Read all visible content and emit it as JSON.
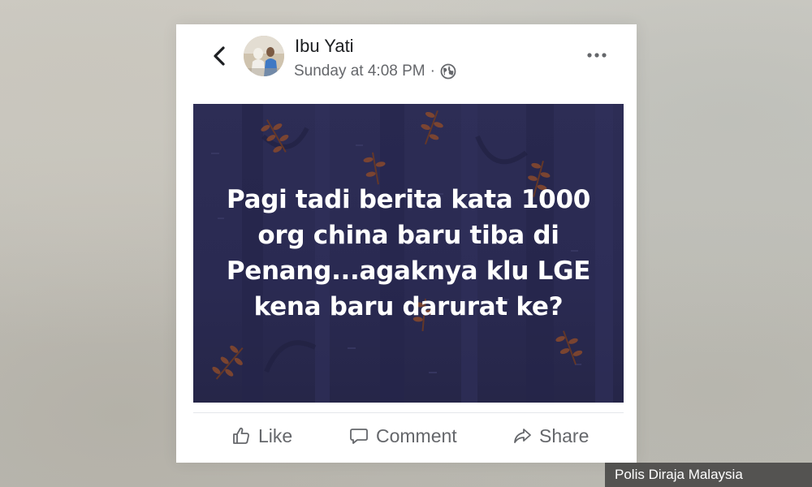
{
  "post": {
    "author": "Ibu Yati",
    "timestamp": "Sunday at 4:08 PM",
    "separator": "·",
    "privacy_icon": "globe-icon",
    "text_lines": [
      "Pagi tadi berita kata 1000",
      "org china baru tiba di",
      "Penang...agaknya klu LGE",
      "kena baru darurat ke?"
    ],
    "image_background": "#2c2c54"
  },
  "actions": {
    "like_label": "Like",
    "comment_label": "Comment",
    "share_label": "Share"
  },
  "icons": {
    "back": "chevron-left-icon",
    "more": "more-horizontal-icon",
    "like": "thumbs-up-icon",
    "comment": "speech-bubble-icon",
    "share": "share-arrow-icon"
  },
  "caption": "Polis Diraja Malaysia",
  "colors": {
    "text_primary": "#1c1e21",
    "text_secondary": "#65676b",
    "image_bg": "#2c2c54",
    "leaf_accent": "#8a4a2c"
  }
}
